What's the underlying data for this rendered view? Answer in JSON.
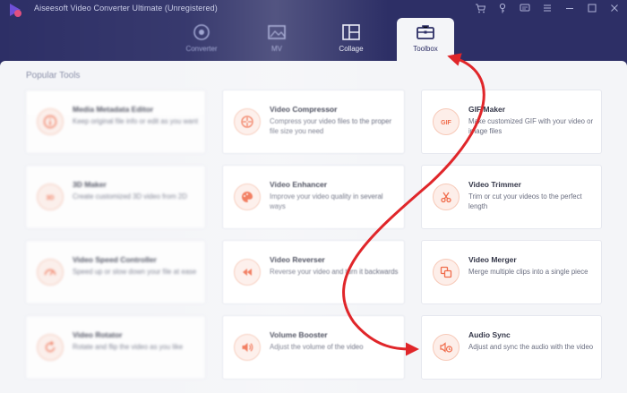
{
  "app": {
    "title": "Aiseesoft Video Converter Ultimate (Unregistered)"
  },
  "tabs": [
    {
      "label": "Converter",
      "icon": "converter-icon"
    },
    {
      "label": "MV",
      "icon": "mv-icon"
    },
    {
      "label": "Collage",
      "icon": "collage-icon"
    },
    {
      "label": "Toolbox",
      "icon": "toolbox-icon",
      "active": true
    }
  ],
  "window_controls": [
    "cart-icon",
    "key-icon",
    "feedback-icon",
    "menu-icon",
    "minimize-icon",
    "maximize-icon",
    "close-icon"
  ],
  "section": {
    "title": "Popular Tools"
  },
  "tools": [
    {
      "title": "Media Metadata Editor",
      "desc": "Keep original file info or edit as you want",
      "icon": "info-icon"
    },
    {
      "title": "Video Compressor",
      "desc": "Compress your video files to the proper file size you need",
      "icon": "compress-icon"
    },
    {
      "title": "GIF Maker",
      "desc": "Make customized GIF with your video or image files",
      "icon": "gif-icon"
    },
    {
      "title": "3D Maker",
      "desc": "Create customized 3D video from 2D",
      "icon": "3d-icon"
    },
    {
      "title": "Video Enhancer",
      "desc": "Improve your video quality in several ways",
      "icon": "palette-icon"
    },
    {
      "title": "Video Trimmer",
      "desc": "Trim or cut your videos to the perfect length",
      "icon": "scissors-icon"
    },
    {
      "title": "Video Speed Controller",
      "desc": "Speed up or slow down your file at ease",
      "icon": "speed-icon"
    },
    {
      "title": "Video Reverser",
      "desc": "Reverse your video and turn it backwards",
      "icon": "reverse-icon"
    },
    {
      "title": "Video Merger",
      "desc": "Merge multiple clips into a single piece",
      "icon": "merge-icon"
    },
    {
      "title": "Video Rotator",
      "desc": "Rotate and flip the video as you like",
      "icon": "rotate-icon"
    },
    {
      "title": "Volume Booster",
      "desc": "Adjust the volume of the video",
      "icon": "volume-icon"
    },
    {
      "title": "Audio Sync",
      "desc": "Adjust and sync the audio with the video",
      "icon": "audio-sync-icon"
    }
  ],
  "colors": {
    "header_bg": "#2d2f66",
    "panel_bg": "#f4f5f8",
    "accent": "#f06b4a",
    "annotation_arrow": "#e0262a"
  }
}
